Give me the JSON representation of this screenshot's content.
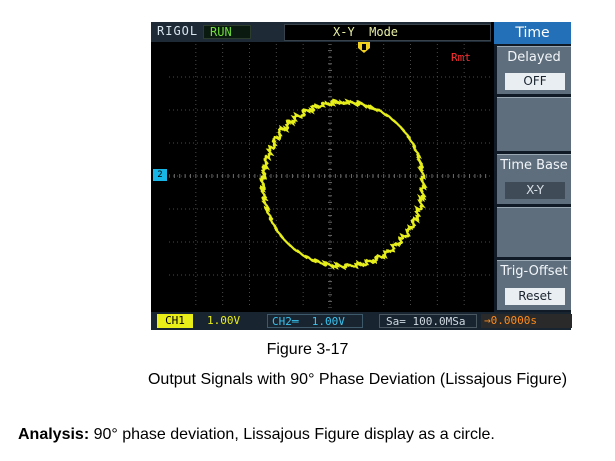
{
  "scope": {
    "brand": "RIGOL",
    "run_status": "RUN",
    "mode_title": "X-Y  Mode",
    "rmt": "Rmt",
    "ch2_marker": "2",
    "menu": {
      "title": "Time",
      "items": [
        {
          "label": "Delayed",
          "value": "OFF"
        },
        {
          "label": "",
          "value": ""
        },
        {
          "label": "Time Base",
          "value": "X-Y"
        },
        {
          "label": "",
          "value": ""
        },
        {
          "label": "Trig-Offset",
          "value": "Reset"
        }
      ]
    },
    "status": {
      "ch1_label": "CH1",
      "ch1_value": "1.00V",
      "ch2_value": "CH2═  1.00V",
      "sample_rate": "Sa= 100.0MSa",
      "trigger_offset": "→0.0000s"
    },
    "colors": {
      "trace": "#e6ee1c",
      "ch2": "#17b6e6",
      "rmt": "#ff3030",
      "menu_title": "#2470b8"
    }
  },
  "figure": {
    "number": "Figure 3-17",
    "caption": "Output Signals with 90° Phase Deviation (Lissajous Figure)"
  },
  "analysis": {
    "label": "Analysis:",
    "text": " 90° phase deviation, Lissajous Figure display as a circle."
  }
}
